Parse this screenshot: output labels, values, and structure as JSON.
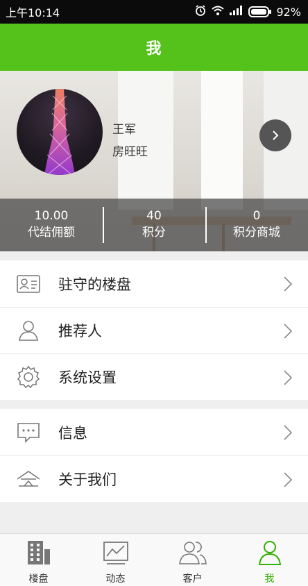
{
  "status_bar": {
    "time": "上午10:14",
    "battery": "92%"
  },
  "header": {
    "title": "我"
  },
  "profile": {
    "name": "王军",
    "company": "房旺旺"
  },
  "stats": [
    {
      "value": "10.00",
      "label": "代结佣额"
    },
    {
      "value": "40",
      "label": "积分"
    },
    {
      "value": "0",
      "label": "积分商城"
    }
  ],
  "menu_group_1": [
    {
      "label": "驻守的楼盘",
      "icon": "id-card-icon"
    },
    {
      "label": "推荐人",
      "icon": "person-icon"
    },
    {
      "label": "系统设置",
      "icon": "gear-icon"
    }
  ],
  "menu_group_2": [
    {
      "label": "信息",
      "icon": "message-icon"
    },
    {
      "label": "关于我们",
      "icon": "house-icon"
    }
  ],
  "tabs": [
    {
      "label": "楼盘",
      "icon": "building-icon"
    },
    {
      "label": "动态",
      "icon": "chart-icon"
    },
    {
      "label": "客户",
      "icon": "people-icon"
    },
    {
      "label": "我",
      "icon": "person-icon",
      "active": true
    }
  ],
  "colors": {
    "accent": "#55c21b",
    "active_tab": "#33b000"
  }
}
